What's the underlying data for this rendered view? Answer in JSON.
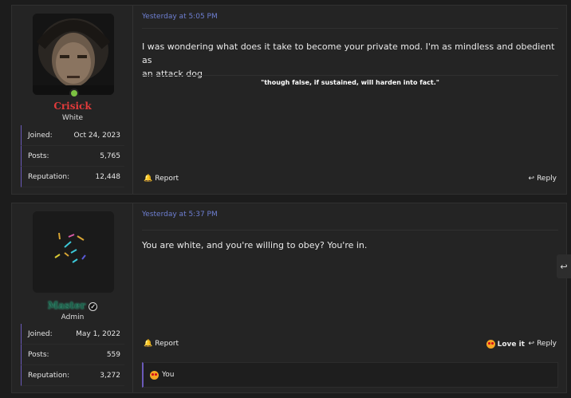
{
  "posts": [
    {
      "user": {
        "name": "Crisick",
        "name_color": "#e23b3b",
        "title": "White",
        "online": true,
        "stats": [
          {
            "label": "Joined:",
            "value": "Oct 24, 2023"
          },
          {
            "label": "Posts:",
            "value": "5,765"
          },
          {
            "label": "Reputation:",
            "value": "12,448"
          }
        ]
      },
      "time": "Yesterday at 5:05 PM",
      "body_lines": [
        "I was wondering what does it take to become your private mod. I'm as mindless and obedient as",
        "an attack dog"
      ],
      "signature": "\"though false, if sustained, will harden into fact.\"",
      "report_label": "Report",
      "reply_label": "Reply"
    },
    {
      "user": {
        "name": "Master",
        "name_color": "#1f5f4a",
        "title": "Admin",
        "verified": true,
        "stats": [
          {
            "label": "Joined:",
            "value": "May 1, 2022"
          },
          {
            "label": "Posts:",
            "value": "559"
          },
          {
            "label": "Reputation:",
            "value": "3,272"
          }
        ]
      },
      "time": "Yesterday at 5:37 PM",
      "body_lines": [
        "You are white, and you're willing to obey? You're in."
      ],
      "report_label": "Report",
      "love_label": "Love it",
      "reply_label": "Reply",
      "reactions_text": "You"
    }
  ],
  "icons": {
    "report": "bell-icon",
    "reply": "reply-arrow-icon",
    "love": "heart-eyes-emoji-icon",
    "verified": "check-badge-icon"
  },
  "colors": {
    "accent": "#6a59b8",
    "time": "#6e7fd2"
  }
}
